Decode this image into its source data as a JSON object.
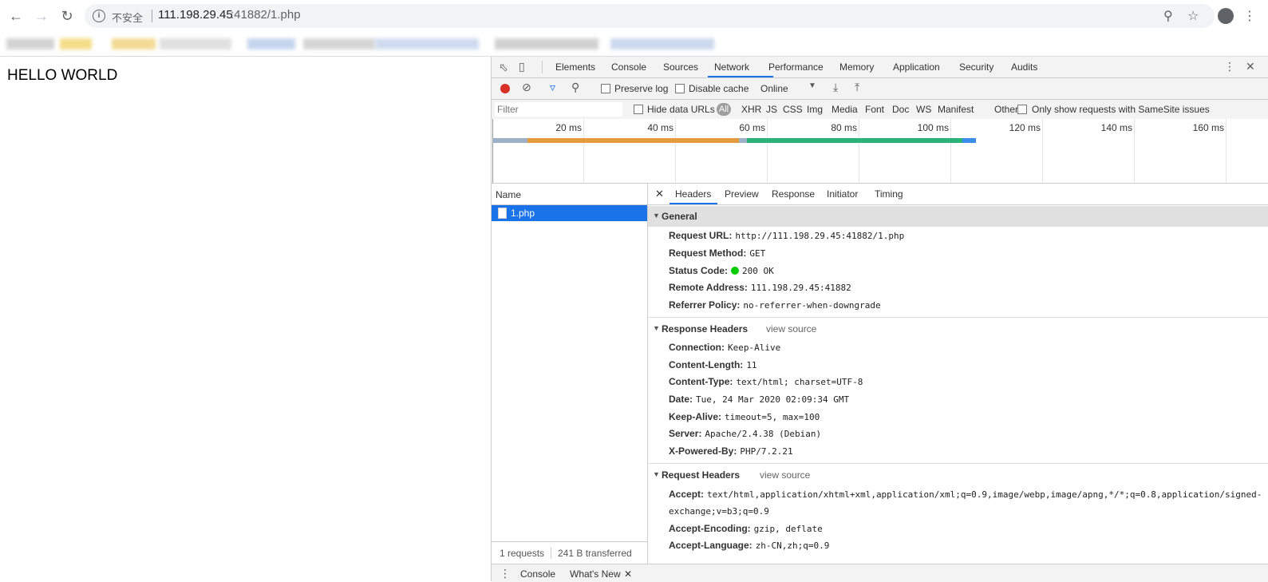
{
  "browser": {
    "insecure_label": "不安全",
    "url_host": "111.198.29.45",
    "url_rest": ":41882/1.php"
  },
  "page": {
    "text": "HELLO WORLD"
  },
  "devtools": {
    "tabs": [
      "Elements",
      "Console",
      "Sources",
      "Network",
      "Performance",
      "Memory",
      "Application",
      "Security",
      "Audits"
    ],
    "toolbar": {
      "preserve_log": "Preserve log",
      "disable_cache": "Disable cache",
      "throttle": "Online"
    },
    "filter": {
      "placeholder": "Filter",
      "hide_data_urls": "Hide data URLs",
      "all": "All",
      "types": [
        "XHR",
        "JS",
        "CSS",
        "Img",
        "Media",
        "Font",
        "Doc",
        "WS",
        "Manifest",
        "Other"
      ],
      "samesite": "Only show requests with SameSite issues"
    },
    "timeline": {
      "ticks": [
        "20 ms",
        "40 ms",
        "60 ms",
        "80 ms",
        "100 ms",
        "120 ms",
        "140 ms",
        "160 ms"
      ]
    },
    "requests": {
      "column": "Name",
      "items": [
        "1.php"
      ],
      "count": "1 requests",
      "transferred": "241 B transferred"
    },
    "detail_tabs": [
      "Headers",
      "Preview",
      "Response",
      "Initiator",
      "Timing"
    ],
    "general": {
      "title": "General",
      "rows": [
        {
          "k": "Request URL:",
          "v": "http://111.198.29.45:41882/1.php"
        },
        {
          "k": "Request Method:",
          "v": "GET"
        },
        {
          "k": "Status Code:",
          "v": "200 OK"
        },
        {
          "k": "Remote Address:",
          "v": "111.198.29.45:41882"
        },
        {
          "k": "Referrer Policy:",
          "v": "no-referrer-when-downgrade"
        }
      ]
    },
    "response_headers": {
      "title": "Response Headers",
      "view_source": "view source",
      "rows": [
        {
          "k": "Connection:",
          "v": "Keep-Alive"
        },
        {
          "k": "Content-Length:",
          "v": "11"
        },
        {
          "k": "Content-Type:",
          "v": "text/html; charset=UTF-8"
        },
        {
          "k": "Date:",
          "v": "Tue, 24 Mar 2020 02:09:34 GMT"
        },
        {
          "k": "Keep-Alive:",
          "v": "timeout=5, max=100"
        },
        {
          "k": "Server:",
          "v": "Apache/2.4.38 (Debian)"
        },
        {
          "k": "X-Powered-By:",
          "v": "PHP/7.2.21"
        }
      ]
    },
    "request_headers": {
      "title": "Request Headers",
      "view_source": "view source",
      "rows": [
        {
          "k": "Accept:",
          "v": "text/html,application/xhtml+xml,application/xml;q=0.9,image/webp,image/apng,*/*;q=0.8,application/signed-"
        },
        {
          "k": "",
          "v": "exchange;v=b3;q=0.9"
        },
        {
          "k": "Accept-Encoding:",
          "v": "gzip, deflate"
        },
        {
          "k": "Accept-Language:",
          "v": "zh-CN,zh;q=0.9"
        }
      ]
    },
    "drawer": {
      "tabs": [
        "Console",
        "What's New"
      ]
    }
  }
}
